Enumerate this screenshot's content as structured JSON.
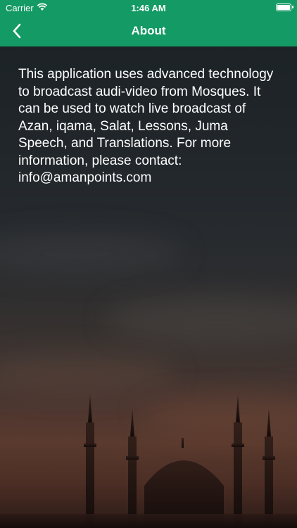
{
  "status_bar": {
    "carrier": "Carrier",
    "time": "1:46 AM",
    "wifi_icon": "wifi-icon",
    "battery_icon": "battery-icon"
  },
  "nav": {
    "title": "About",
    "back_icon": "chevron-left-icon",
    "bar_color": "#149a64"
  },
  "about": {
    "text": "This application uses advanced technology to broadcast audi-video from Mosques. It can be used to watch live broadcast of Azan, iqama, Salat, Lessons, Juma Speech, and Translations. For more information, please contact: info@amanpoints.com"
  }
}
